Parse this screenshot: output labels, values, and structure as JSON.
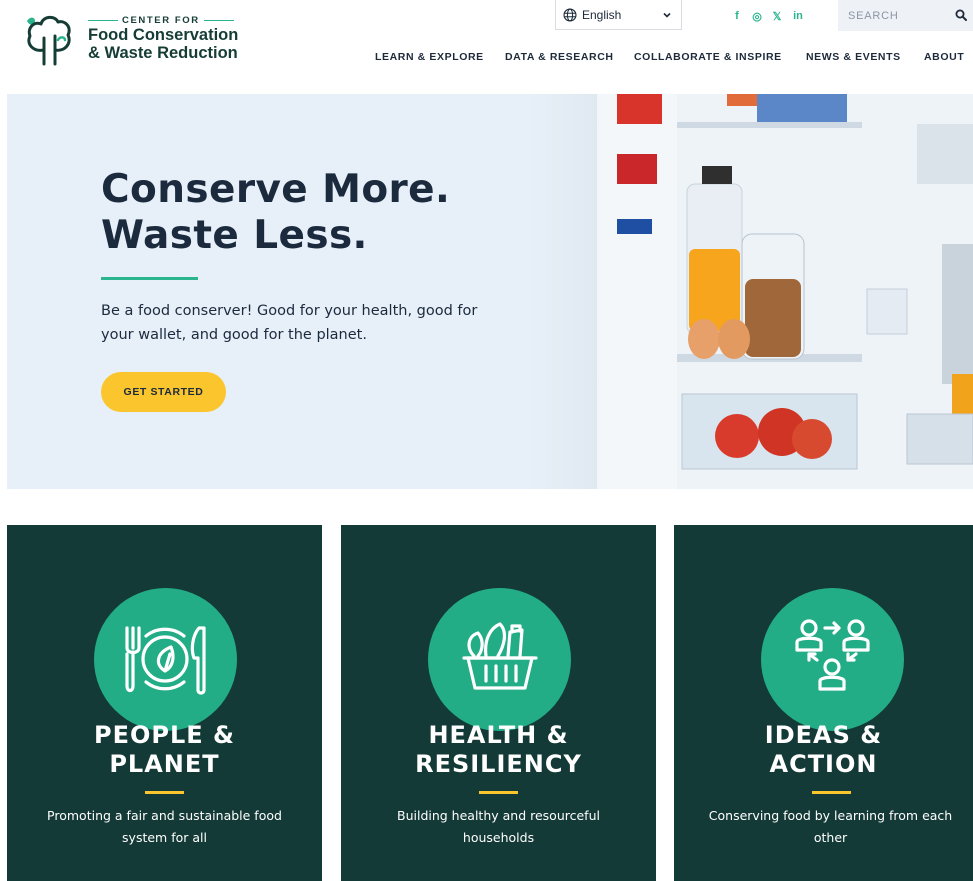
{
  "colors": {
    "brand_dark": "#163c36",
    "accent_green": "#2bb58e",
    "accent_yellow": "#fbc52d",
    "card_bg": "#133a36",
    "hero_bg": "#e7eff8"
  },
  "logo": {
    "kicker": "CENTER FOR",
    "line1": "Food Conservation",
    "line2": "& Waste Reduction",
    "icon": "tree-icon"
  },
  "language": {
    "selected": "English",
    "icon": "globe-icon"
  },
  "social": [
    {
      "name": "facebook-icon",
      "glyph": "f"
    },
    {
      "name": "instagram-icon",
      "glyph": "◎"
    },
    {
      "name": "x-icon",
      "glyph": "𝕏"
    },
    {
      "name": "linkedin-icon",
      "glyph": "in"
    }
  ],
  "search": {
    "placeholder": "SEARCH",
    "icon": "search-icon"
  },
  "nav": [
    "LEARN & EXPLORE",
    "DATA & RESEARCH",
    "COLLABORATE & INSPIRE",
    "NEWS & EVENTS",
    "ABOUT"
  ],
  "hero": {
    "title_line1": "Conserve More.",
    "title_line2": "Waste Less.",
    "text": "Be a food conserver! Good for your health, good for your wallet, and good for the planet.",
    "cta": "GET STARTED"
  },
  "cards": [
    {
      "title_line1": "PEOPLE &",
      "title_line2": "PLANET",
      "description": "Promoting a fair and sustainable food system for all",
      "icon": "plate-leaf-icon"
    },
    {
      "title_line1": "HEALTH &",
      "title_line2": "RESILIENCY",
      "description": "Building healthy and resourceful households",
      "icon": "grocery-basket-icon"
    },
    {
      "title_line1": "IDEAS &",
      "title_line2": "ACTION",
      "description": "Conserving food by learning from each other",
      "icon": "people-exchange-icon"
    }
  ]
}
